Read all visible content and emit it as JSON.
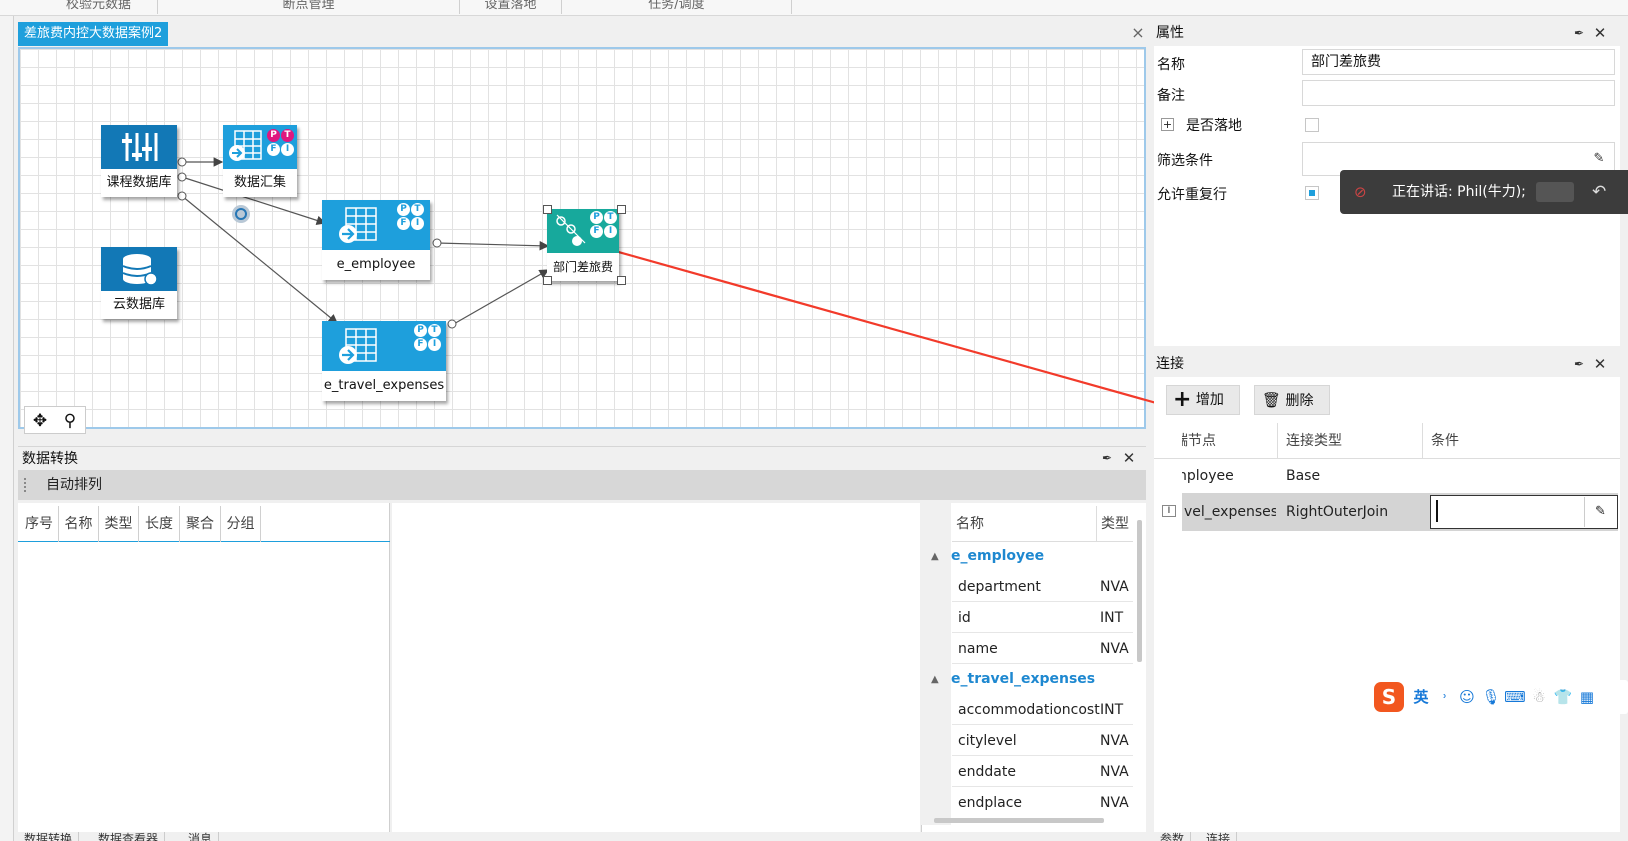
{
  "top_tabs": [
    "校验元数据",
    "断点管理",
    "设置落地",
    "任务/调度"
  ],
  "designer": {
    "tab_title": "差旅费内控大数据案例2",
    "close_glyph": "×"
  },
  "nodes": {
    "course_db": {
      "label": "课程数据库"
    },
    "data_summary": {
      "label": "数据汇集",
      "badges": [
        "P",
        "T",
        "F",
        "I"
      ]
    },
    "cloud_db": {
      "label": "云数据库"
    },
    "e_employee": {
      "label": "e_employee",
      "badges": [
        "P",
        "T",
        "F",
        "I"
      ]
    },
    "e_travel": {
      "label": "e_travel_expenses",
      "badges": [
        "P",
        "T",
        "F",
        "I"
      ]
    },
    "dept_travel": {
      "label": "部门差旅费",
      "badges": [
        "P",
        "T",
        "F",
        "I"
      ]
    }
  },
  "properties": {
    "title": "属性",
    "rows": {
      "name_label": "名称",
      "name_value": "部门差旅费",
      "remark_label": "备注",
      "remark_value": "",
      "land_label": "是否落地",
      "land_expand": "+",
      "filter_label": "筛选条件",
      "filter_value": "",
      "dup_label": "允许重复行"
    },
    "allow_duplicates": true,
    "is_landed": false
  },
  "voice_overlay": {
    "text": "正在讲话: Phil(牛力);"
  },
  "connection": {
    "title": "连接",
    "add_label": "增加",
    "delete_label": "删除",
    "columns": [
      "端节点",
      "连接类型",
      "条件"
    ],
    "rows": [
      {
        "node": "nployee",
        "type": "Base",
        "condition": ""
      },
      {
        "node": "vel_expenses",
        "type": "RightOuterJoin",
        "condition": ""
      }
    ]
  },
  "transform": {
    "title": "数据转换",
    "auto_arrange": "自动排列",
    "columns": [
      "序号",
      "名称",
      "类型",
      "长度",
      "聚合",
      "分组"
    ]
  },
  "field_tree": {
    "col_name": "名称",
    "col_type": "类型",
    "groups": [
      {
        "name": "e_employee",
        "fields": [
          {
            "name": "department",
            "type": "NVA"
          },
          {
            "name": "id",
            "type": "INT"
          },
          {
            "name": "name",
            "type": "NVA"
          }
        ]
      },
      {
        "name": "e_travel_expenses",
        "fields": [
          {
            "name": "accommodationcost",
            "type": "INT"
          },
          {
            "name": "citylevel",
            "type": "NVA"
          },
          {
            "name": "enddate",
            "type": "NVA"
          },
          {
            "name": "endplace",
            "type": "NVA"
          }
        ]
      }
    ]
  },
  "ime": {
    "lang": "英"
  },
  "bottom_tabs": [
    "数据转换",
    "数据查看器",
    "消息"
  ],
  "bottom_right_tabs": [
    "参数",
    "连接"
  ],
  "colors": {
    "accent": "#1e9fdc",
    "teal": "#17a99c",
    "annotation": "#f23a2a"
  }
}
